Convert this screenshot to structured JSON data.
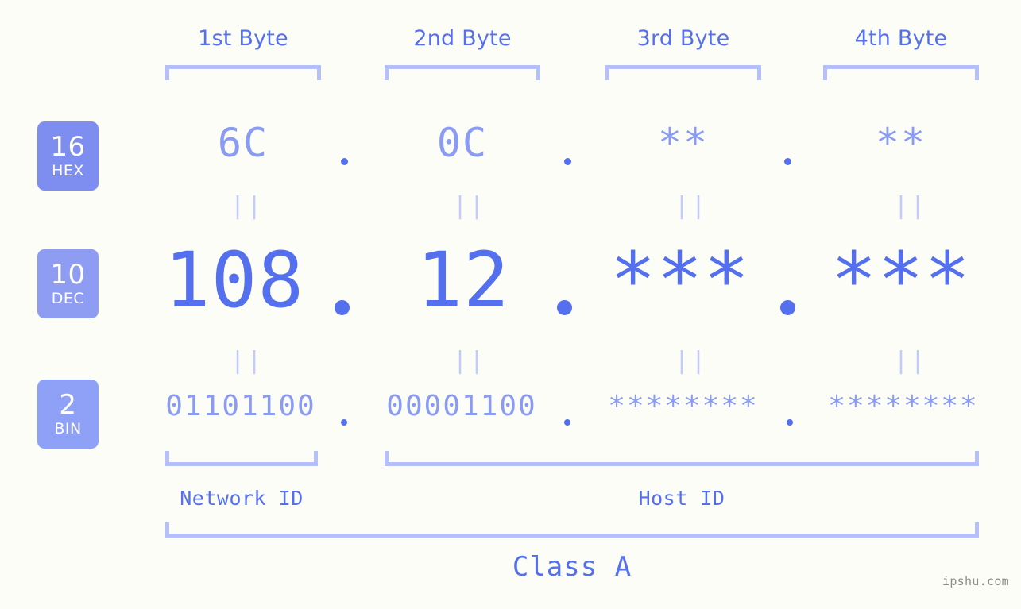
{
  "background_color": "#fdfdf7",
  "accent_color": "#5570ee",
  "accent_light_color": "#8a9bf3",
  "bracket_color": "#b5c0fb",
  "badge_color": "#7d8ef0",
  "byte_headers": [
    {
      "label": "1st Byte"
    },
    {
      "label": "2nd Byte"
    },
    {
      "label": "3rd Byte"
    },
    {
      "label": "4th Byte"
    }
  ],
  "rows": [
    {
      "radix": "16",
      "radix_name": "HEX",
      "values": [
        "6C",
        "0C",
        "**",
        "**"
      ]
    },
    {
      "radix": "10",
      "radix_name": "DEC",
      "values": [
        "108",
        "12",
        "***",
        "***"
      ]
    },
    {
      "radix": "2",
      "radix_name": "BIN",
      "values": [
        "01101100",
        "00001100",
        "********",
        "********"
      ]
    }
  ],
  "equality_marks": {
    "hex_to_dec": [
      "||",
      "||",
      "||",
      "||"
    ],
    "dec_to_bin": [
      "||",
      "||",
      "||",
      "||"
    ]
  },
  "separators": {
    "dot": "."
  },
  "sections": {
    "network_id": "Network ID",
    "host_id": "Host ID",
    "class": "Class A"
  },
  "watermark": "ipshu.com"
}
